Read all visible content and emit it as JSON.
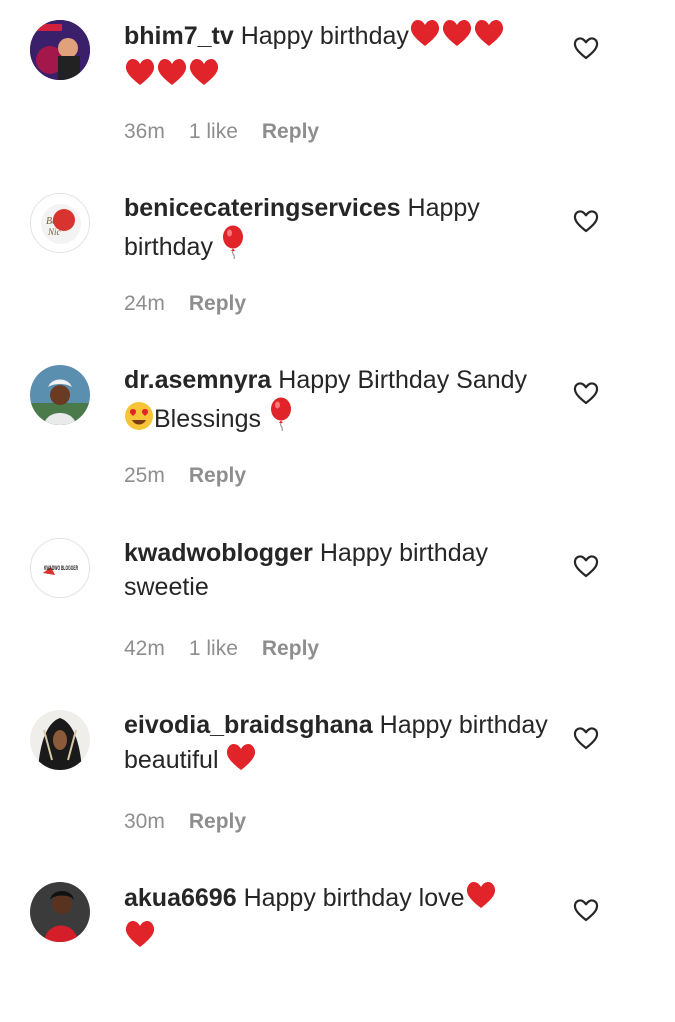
{
  "comments": [
    {
      "username": "bhim7_tv",
      "text": "Happy birthday",
      "trailing_emojis": [
        "red-heart",
        "red-heart",
        "red-heart",
        "red-heart",
        "red-heart",
        "red-heart"
      ],
      "time": "36m",
      "likes": "1 like",
      "reply": "Reply",
      "avatar": "dark-photo-avatar"
    },
    {
      "username": "benicecateringservices",
      "text": "Happy birthday",
      "trailing_emojis": [
        "balloon"
      ],
      "time": "24m",
      "likes": "",
      "reply": "Reply",
      "avatar": "logo-avatar"
    },
    {
      "username": "dr.asemnyra",
      "text_before": "Happy Birthday Sandy",
      "text_after": "Blessings",
      "mid_emoji": "heart-eyes",
      "trailing_emojis": [
        "balloon"
      ],
      "time": "25m",
      "likes": "",
      "reply": "Reply",
      "avatar": "photo-avatar"
    },
    {
      "username": "kwadwoblogger",
      "text": "Happy birthday sweetie",
      "trailing_emojis": [],
      "time": "42m",
      "likes": "1 like",
      "reply": "Reply",
      "avatar": "logo-avatar",
      "avatar_text": "KWADWO BLOGGER"
    },
    {
      "username": "eivodia_braidsghana",
      "text": "Happy birthday beautiful",
      "trailing_emojis": [
        "red-heart"
      ],
      "time": "30m",
      "likes": "",
      "reply": "Reply",
      "avatar": "braids-photo-avatar"
    },
    {
      "username": "akua6696",
      "text": "Happy birthday love",
      "trailing_emojis": [
        "red-heart",
        "red-heart"
      ],
      "time": "",
      "likes": "",
      "reply": "",
      "avatar": "photo-avatar"
    }
  ],
  "colors": {
    "text": "#262626",
    "meta": "#8e8e8e",
    "heart": "#e0242a"
  },
  "icons": {
    "like": "heart-outline-icon"
  }
}
